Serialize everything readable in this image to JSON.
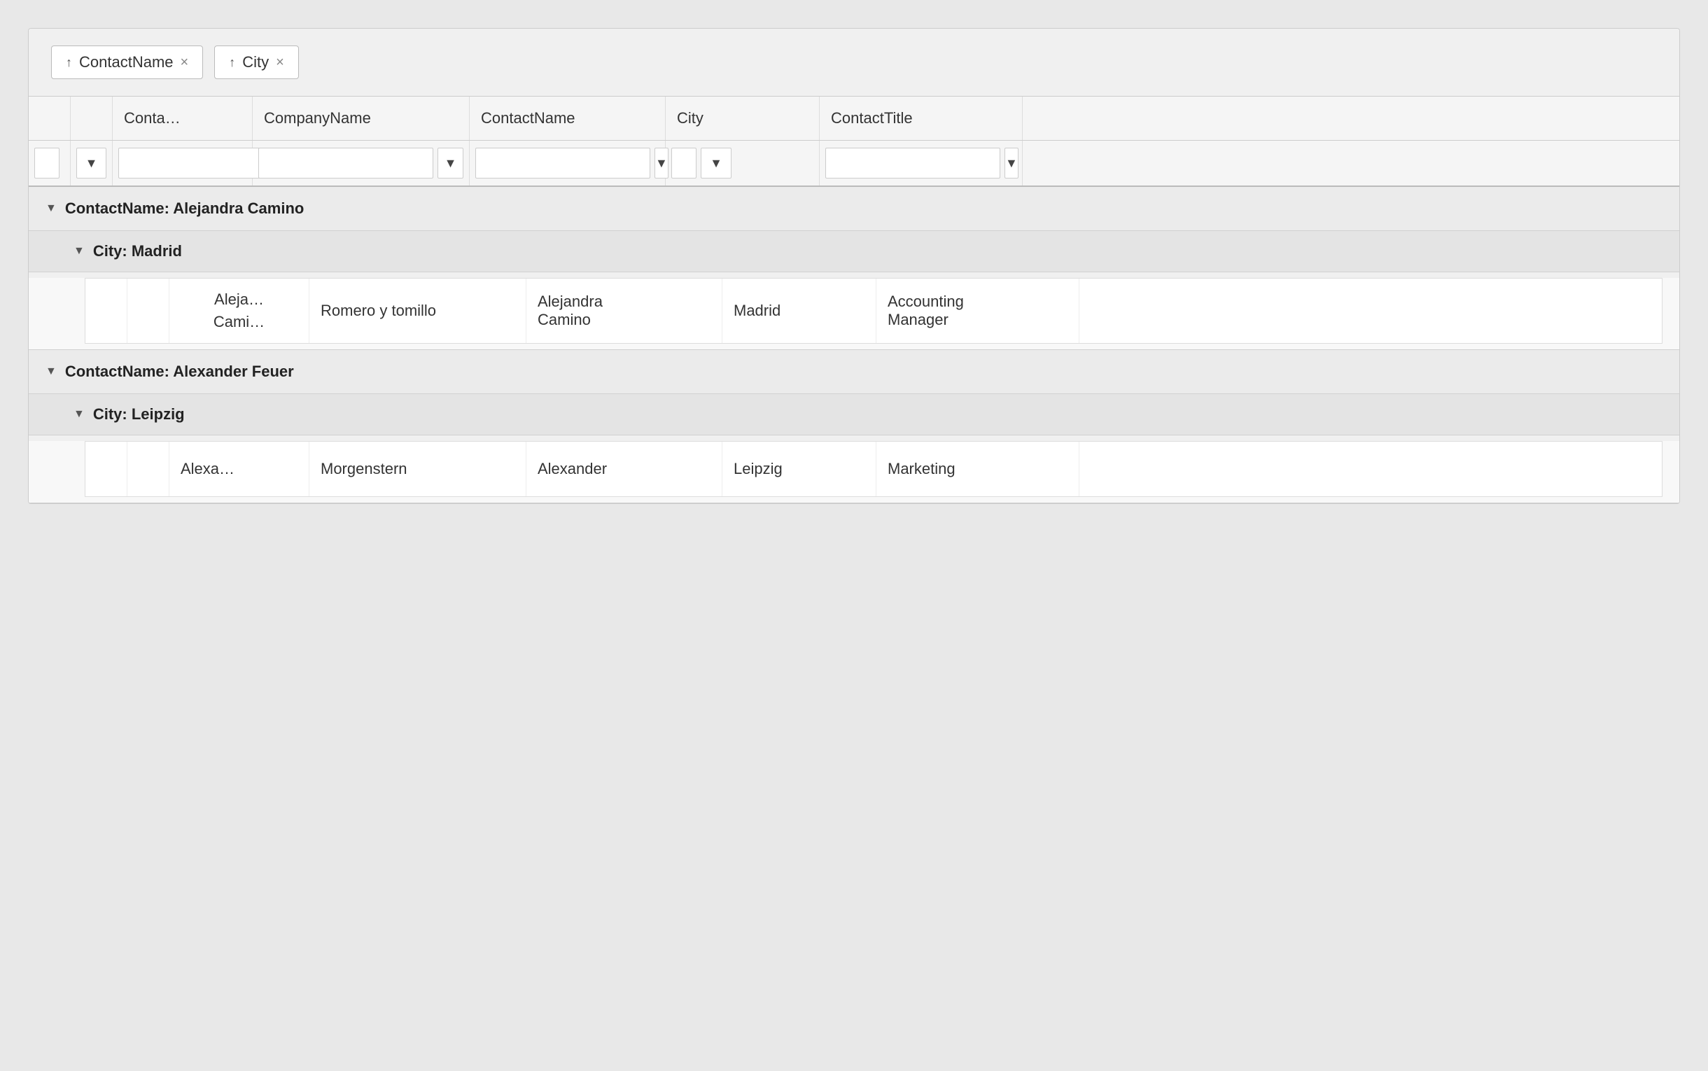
{
  "sort_chips": [
    {
      "arrow": "↑",
      "label": "ContactName",
      "close": "×"
    },
    {
      "arrow": "↑",
      "label": "City",
      "close": "×"
    }
  ],
  "columns": [
    {
      "label": ""
    },
    {
      "label": ""
    },
    {
      "label": "Conta…"
    },
    {
      "label": "CompanyName"
    },
    {
      "label": "ContactName"
    },
    {
      "label": "City"
    },
    {
      "label": "ContactTitle"
    }
  ],
  "groups": [
    {
      "group1_label": "ContactName: Alejandra Camino",
      "subgroups": [
        {
          "group2_label": "City: Madrid",
          "rows": [
            {
              "col1_line1": "Aleja…",
              "col1_line2": "Cami…",
              "company": "Romero y tomillo",
              "contact": "Alejandra\nCamino",
              "city": "Madrid",
              "title": "Accounting\nManager"
            }
          ]
        }
      ]
    },
    {
      "group1_label": "ContactName: Alexander Feuer",
      "subgroups": [
        {
          "group2_label": "City: Leipzig",
          "rows": [
            {
              "col1_line1": "Alexa…",
              "col1_line2": "",
              "company": "Morgenstern",
              "contact": "Alexander",
              "city": "Leipzig",
              "title": "Marketing"
            }
          ]
        }
      ]
    }
  ],
  "filter_icon": "▼",
  "chevron_down": "▼",
  "filter_unicode": "⊿"
}
